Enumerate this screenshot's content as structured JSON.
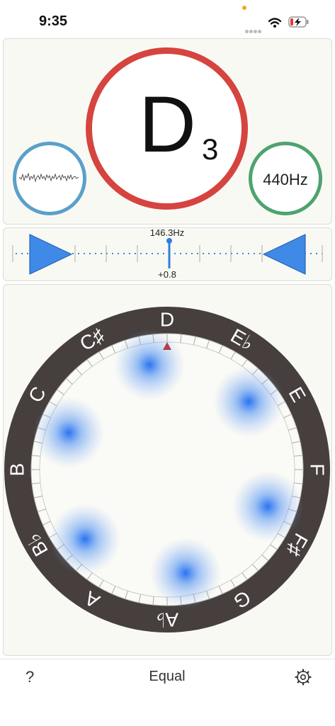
{
  "status_bar": {
    "time": "9:35",
    "icons": [
      "signal-dots-icon",
      "wifi-icon",
      "battery-charging-icon"
    ]
  },
  "tuner": {
    "note": "D",
    "octave": "3",
    "reference": "440Hz",
    "frequency": "146.3Hz",
    "cents": "+0.8"
  },
  "tuning_circle": {
    "notes": [
      "D",
      "E♭",
      "E",
      "F",
      "F♯",
      "G",
      "A♭",
      "A",
      "B♭",
      "B",
      "C",
      "C♯"
    ]
  },
  "bottom_bar": {
    "help_label": "?",
    "mode_label": "Equal",
    "settings_icon": "gear-icon"
  },
  "colors": {
    "note_ring": "#d64440",
    "waveform_ring": "#5aa0c9",
    "reference_ring": "#4ea36e",
    "pointer_triangles": "#3f8ae6",
    "circle_band": "#463f3e",
    "glow": "#2a73f0"
  }
}
